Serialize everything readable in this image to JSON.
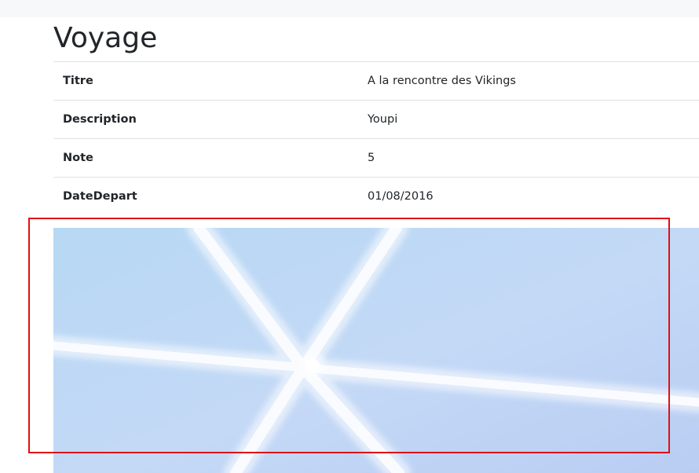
{
  "page": {
    "title": "Voyage"
  },
  "details": {
    "rows": [
      {
        "label": "Titre",
        "value": "A la rencontre des Vikings"
      },
      {
        "label": "Description",
        "value": "Youpi"
      },
      {
        "label": "Note",
        "value": "5"
      },
      {
        "label": "DateDepart",
        "value": "01/08/2016"
      }
    ]
  },
  "image": {
    "subject": "light-beams-on-blue-background"
  },
  "colors": {
    "highlight": "#e01010",
    "photo_sky": "#bcd6f5",
    "table_border": "#dee2e6"
  }
}
